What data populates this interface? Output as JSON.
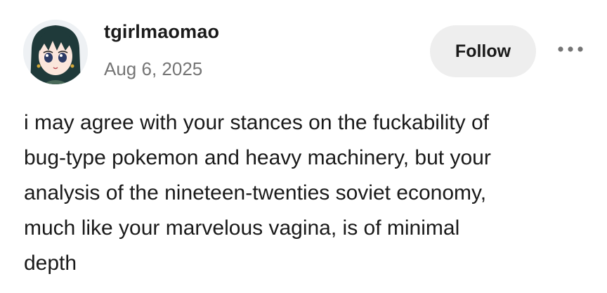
{
  "post": {
    "author": {
      "username": "tgirlmaomao",
      "avatar_icon": "anime-avatar-icon"
    },
    "date": "Aug 6, 2025",
    "follow_label": "Follow",
    "more_icon": "more-dots-icon",
    "body_lines": [
      "i may agree with your stances on the fuckability of",
      "bug-type pokemon and heavy machinery, but your",
      "analysis of the nineteen-twenties soviet economy,",
      "much like your marvelous vagina, is of minimal",
      "depth"
    ]
  },
  "colors": {
    "text": "#1a1a1a",
    "muted": "#757575",
    "button_bg": "#eeeeee",
    "avatar_hair": "#1f3a3a",
    "avatar_bg": "#eef1f4"
  }
}
